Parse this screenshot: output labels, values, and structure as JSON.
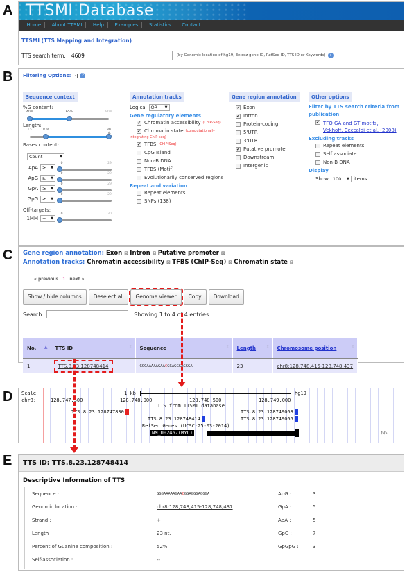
{
  "panel_labels": [
    "A",
    "B",
    "C",
    "D",
    "E"
  ],
  "A": {
    "banner_title": "TTSMI Database",
    "nav": [
      ". Home",
      ". About TTSMI",
      ". Help",
      ". Examples",
      ". Statistics",
      ". Contact"
    ],
    "subtitle": "TTSMI (TTS Mapping and Integration)",
    "search_label": "TTS search term:",
    "search_value": "4609",
    "search_hint": "(by Genomic location of hg19, Entrez gene ID, RefSeq ID, TTS ID or Keywords)",
    "help_icon": "?"
  },
  "B": {
    "heading": "Filtering Options:",
    "collapse_icon": "-",
    "help_icon": "?",
    "sequence_context": {
      "title": "Sequence context",
      "g_content": {
        "label": "%G content:",
        "ticks": [
          "40%",
          "65%",
          "90%"
        ],
        "range": [
          40,
          65
        ],
        "min": 40,
        "max": 90
      },
      "length": {
        "label": "Length:",
        "ticks": [
          "15",
          "18 nt.",
          "30 nt."
        ],
        "range": [
          18,
          30
        ],
        "min": 15,
        "max": 30
      },
      "bases_label": "Bases content:",
      "bases_mode": "Count",
      "bases": [
        {
          "name": "ApA",
          "op": "≥",
          "min_tick": "0",
          "max_tick": "29",
          "value": 0
        },
        {
          "name": "ApG",
          "op": "≥",
          "min_tick": "0",
          "max_tick": "29",
          "value": 0
        },
        {
          "name": "GpA",
          "op": "≥",
          "min_tick": "0",
          "max_tick": "29",
          "value": 0
        },
        {
          "name": "GpG",
          "op": "≥",
          "min_tick": "0",
          "max_tick": "29",
          "value": 0
        }
      ],
      "off_targets_label": "Off-targets:",
      "off_target": {
        "name": "1MM",
        "op": "=",
        "min_tick": "0",
        "max_tick": "30",
        "value": 0
      }
    },
    "annotation_tracks": {
      "title": "Annotation tracks",
      "logical_label": "Logical",
      "logical_value": "OR",
      "gre_title": "Gene regulatory elements",
      "gre_items": [
        {
          "label": "Chromatin accessibility",
          "note": "(ChIP-Seq)",
          "checked": true
        },
        {
          "label": "Chromatin state",
          "note": "(computationally",
          "checked": true
        },
        {
          "label": "TFBS",
          "note": "(ChIP-Seq)",
          "checked": true
        },
        {
          "label": "CpG Island",
          "note": "",
          "checked": false
        },
        {
          "label": "Non-B DNA",
          "note": "",
          "checked": false
        },
        {
          "label": "TFBS (Motif)",
          "note": "",
          "checked": false
        },
        {
          "label": "Evolutionarily conserved regions",
          "note": "",
          "checked": false
        }
      ],
      "chromatin_state_note2": "integrating ChIP-seq)",
      "rv_title": "Repeat and variation",
      "rv_items": [
        {
          "label": "Repeat elements",
          "checked": false
        },
        {
          "label": "SNPs (138)",
          "checked": false
        }
      ]
    },
    "gene_region": {
      "title": "Gene region annotation",
      "items": [
        {
          "label": "Exon",
          "checked": true
        },
        {
          "label": "Intron",
          "checked": true
        },
        {
          "label": "Protein-coding",
          "checked": false
        },
        {
          "label": "5'UTR",
          "checked": false
        },
        {
          "label": "3'UTR",
          "checked": false
        },
        {
          "label": "Putative promoter",
          "checked": true
        },
        {
          "label": "Downstream",
          "checked": false
        },
        {
          "label": "Intergenic",
          "checked": false
        }
      ]
    },
    "other_options": {
      "title": "Other options",
      "filter_title": "Filter by TTS search criteria from publication",
      "publication_line1": "TFO GA and GT motifs,",
      "publication_line2": "Vekhoff, Ceccaldi et al. (2008)",
      "publication_checked": true,
      "excluding_title": "Excluding tracks",
      "excluding_items": [
        {
          "label": "Repeat elements",
          "checked": false
        },
        {
          "label": "Self associate",
          "checked": false
        },
        {
          "label": "Non-B DNA",
          "checked": false
        }
      ],
      "display_title": "Display",
      "show_label": "Show",
      "show_value": "100",
      "items_label": "items"
    }
  },
  "C": {
    "gene_region_key": "Gene region annotation:",
    "gene_region_tags": [
      "Exon",
      "Intron",
      "Putative promoter"
    ],
    "annotation_key": "Annotation tracks:",
    "annotation_tags": [
      "Chromatin accessibility",
      "TFBS (ChIP-Seq)",
      "Chromatin state"
    ],
    "remove_glyph": "⊠",
    "pager": {
      "prev": "« previous",
      "current": "1",
      "next": "next »"
    },
    "buttons": [
      "Show / hide columns",
      "Deselect all",
      "Genome viewer",
      "Copy",
      "Download"
    ],
    "search_label": "Search:",
    "search_value": "",
    "entries_info": "Showing 1 to 4 of 4 entries",
    "columns": [
      "No.",
      "TTS ID",
      "Sequence",
      "Length",
      "Chromosome position"
    ],
    "rows": [
      {
        "no": "1",
        "tts_id": "TTS.8.23.128748414",
        "seq_pre": "GGGAAAAAGAA",
        "seq_mid": "C",
        "seq_post": "GGAGGGAGGGA",
        "length": "23",
        "position": "chr8:128,748,415-128,748,437"
      }
    ]
  },
  "D": {
    "scale_label": "Scale",
    "scale_value": "1 kb",
    "assembly": "hg19",
    "chrom_label": "chr8:",
    "coords": [
      "128,747,500",
      "128,748,000",
      "128,748,500",
      "128,749,000"
    ],
    "track_title": "TTS from TTSMI database",
    "features": [
      {
        "id": "TTS.8.23.128747830",
        "strand": "-",
        "color": "#e52222"
      },
      {
        "id": "TTS.8.23.128748414",
        "strand": "+",
        "color": "#1f3fe0"
      },
      {
        "id": "TTS.8.23.128749063",
        "strand": "+",
        "color": "#1f3fe0"
      },
      {
        "id": "TTS.8.23.128749065",
        "strand": "+",
        "color": "#1f3fe0"
      }
    ],
    "refseq_title": "RefSeq Genes (UCSC:25-03-2014)",
    "gene_label": "NM_002467(MYC)"
  },
  "E": {
    "header": "TTS ID: TTS.8.23.128748414",
    "subheader": "Descriptive Information of TTS",
    "left": [
      {
        "key": "Sequence :",
        "value": "GGGAAAAAGAACGGAGGGAGGGA"
      },
      {
        "key": "Genomic location :",
        "value": "chr8:128,748,415-128,748,437"
      },
      {
        "key": "Strand :",
        "value": "+"
      },
      {
        "key": "Length :",
        "value": "23 nt."
      },
      {
        "key": "Percent of Guanine composition :",
        "value": "52%"
      },
      {
        "key": "Self-association :",
        "value": "--"
      }
    ],
    "seq_pre": "GGGAAAAAGAA",
    "seq_mid": "C",
    "seq_post": "GGAGGGAGGGA",
    "right": [
      {
        "key": "ApG :",
        "value": "3"
      },
      {
        "key": "GpA :",
        "value": "5"
      },
      {
        "key": "ApA :",
        "value": "5"
      },
      {
        "key": "GpG :",
        "value": "7"
      },
      {
        "key": "GpGpG :",
        "value": "3"
      }
    ]
  },
  "colors": {
    "accent_blue": "#3366cc",
    "highlight_red": "#e31b1b",
    "table_header": "#ccccf7",
    "nav_bg": "#333333"
  }
}
